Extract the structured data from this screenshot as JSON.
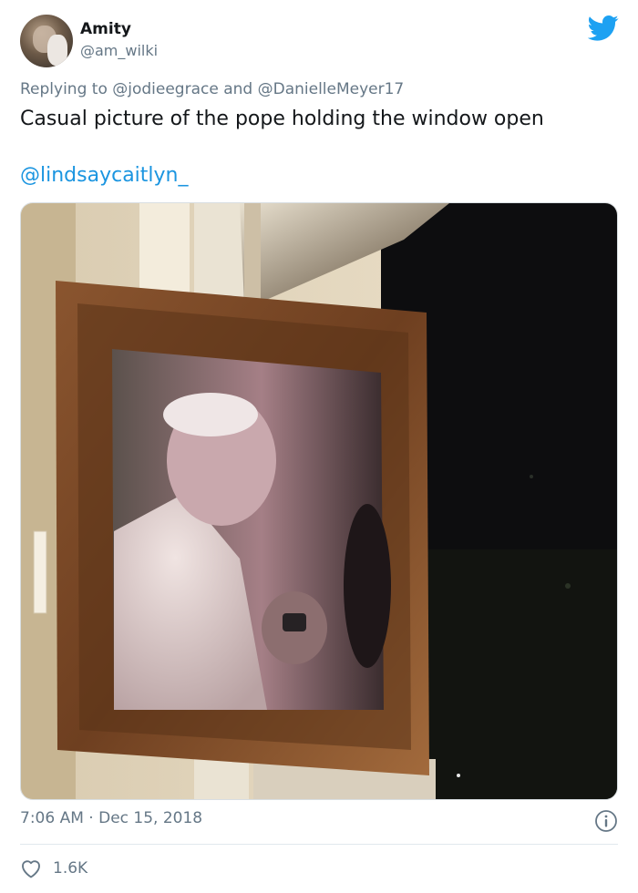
{
  "tweet": {
    "user": {
      "name": "Amity",
      "handle": "@am_wilki"
    },
    "reply": {
      "prefix": "Replying to",
      "mention1": "@jodieegrace",
      "conjunction": "and",
      "mention2": "@DanielleMeyer17"
    },
    "text": "Casual picture of the pope holding the window open",
    "mention": "@lindsaycaitlyn_",
    "time": "7:06 AM",
    "separator": "·",
    "date": "Dec 15, 2018",
    "likes": "1.6K"
  },
  "icons": {
    "brand": "twitter-bird-icon",
    "info": "info-icon",
    "like": "heart-icon"
  },
  "colors": {
    "link": "#1b95e0",
    "twitter_blue": "#1da1f2",
    "secondary_text": "#657786"
  }
}
